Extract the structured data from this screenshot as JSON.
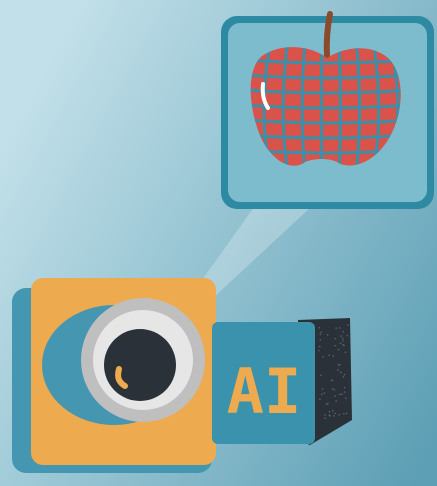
{
  "colors": {
    "background_light": "#c2e0e9",
    "background_dark": "#5d9fb5",
    "frame_fill": "#7cbccd",
    "frame_stroke": "#2e8aa3",
    "apple_red": "#d9534a",
    "apple_grid": "#3b8fa8",
    "stem": "#8a4a2b",
    "camera_orange": "#eeaa4f",
    "camera_shadow": "#4596b0",
    "lens_ring": "#bfbfbf",
    "lens_core": "#2b3138",
    "ai_cube_front": "#3b92ad",
    "ai_cube_side": "#2b3138",
    "ai_text": "#eeaa4f"
  },
  "icons": {
    "detected_object": "apple-icon",
    "device": "camera-icon",
    "processor": "ai-cube-icon"
  },
  "ai_cube": {
    "label": "AI"
  }
}
